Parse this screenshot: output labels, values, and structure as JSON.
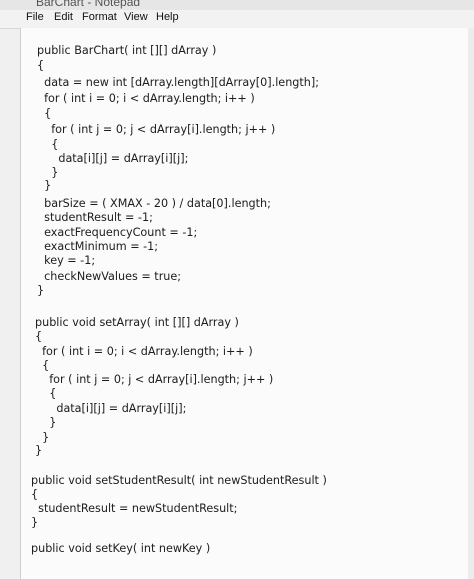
{
  "window": {
    "title": "BarChart - Notepad"
  },
  "menu": [
    "File",
    "Edit",
    "Format",
    "View",
    "Help"
  ],
  "code_lines": [
    "public BarChart( int [][] dArray )",
    "{",
    "  data = new int [dArray.length][dArray[0].length];",
    "  for ( int i = 0; i < dArray.length; i++ )",
    "  {",
    "    for ( int j = 0; j < dArray[i].length; j++ )",
    "    {",
    "      data[i][j] = dArray[i][j];",
    "    }",
    "  }",
    "  barSize = ( XMAX - 20 ) / data[0].length;",
    "  studentResult = -1;",
    "  exactFrequencyCount = -1;",
    "  exactMinimum = -1;",
    "  key = -1;",
    "  checkNewValues = true;",
    "}",
    "public void setArray( int [][] dArray )",
    "{",
    "  for ( int i = 0; i < dArray.length; i++ )",
    "  {",
    "    for ( int j = 0; j < dArray[i].length; j++ )",
    "    {",
    "      data[i][j] = dArray[i][j];",
    "    }",
    "  }",
    "}",
    "public void setStudentResult( int newStudentResult )",
    "{",
    "  studentResult = newStudentResult;",
    "}",
    "public void setKey( int newKey )"
  ]
}
